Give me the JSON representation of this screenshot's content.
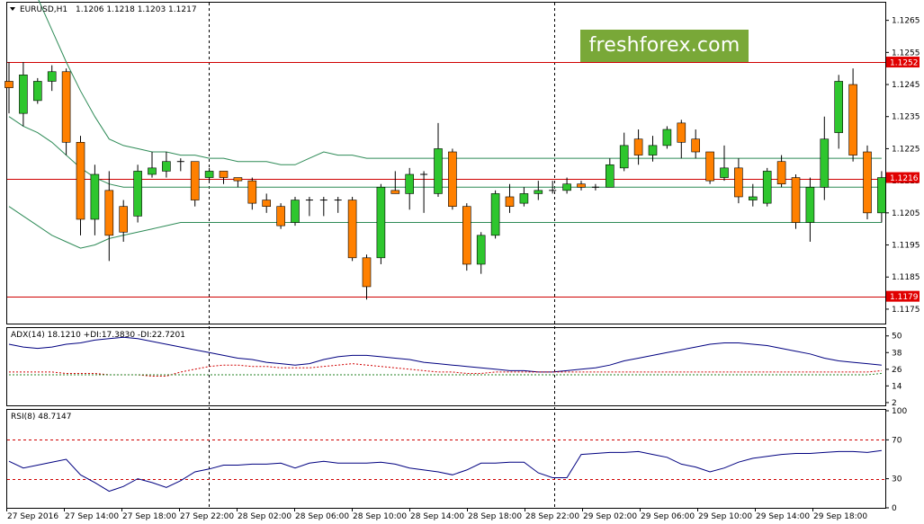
{
  "header": {
    "symbol": "EURUSD,H1",
    "ohlc": "1.1206 1.1218 1.1203 1.1217",
    "adx_label": "ADX(14) 18.1210 +DI:17.3830 -DI:22.7201",
    "rsi_label": "RSI(8) 48.7147"
  },
  "watermark": "freshforex.com",
  "chart_data": [
    {
      "type": "candlestick",
      "title": "EURUSD,H1",
      "ylim": [
        1.11705,
        1.12705
      ],
      "yticks": [
        "1.1265",
        "1.1255",
        "1.1245",
        "1.1235",
        "1.1225",
        "1.1215",
        "1.1205",
        "1.1195",
        "1.1185",
        "1.1175"
      ],
      "price_labels": [
        {
          "text": "1.1252",
          "value": 1.1252,
          "color": "#e00000"
        },
        {
          "text": "1.1216",
          "value": 1.1216,
          "color": "#e00000"
        },
        {
          "text": "1.1179",
          "value": 1.1179,
          "color": "#e00000"
        }
      ],
      "hlines": [
        {
          "value": 1.1252,
          "color": "#d00000"
        },
        {
          "value": 1.12155,
          "color": "#d00000"
        },
        {
          "value": 1.1179,
          "color": "#d00000"
        }
      ],
      "colors": {
        "bull": "#2ec62e",
        "bear": "#ff8000",
        "doji": "#000000",
        "bands": "#2e8b57"
      },
      "candles": [
        [
          1.1246,
          1.1244,
          1.1252,
          1.1236
        ],
        [
          1.1236,
          1.1248,
          1.1252,
          1.1232
        ],
        [
          1.124,
          1.1246,
          1.1247,
          1.1239
        ],
        [
          1.1246,
          1.1249,
          1.1251,
          1.1243
        ],
        [
          1.1249,
          1.1227,
          1.125,
          1.1223
        ],
        [
          1.1227,
          1.1203,
          1.1229,
          1.1198
        ],
        [
          1.1203,
          1.1217,
          1.122,
          1.1198
        ],
        [
          1.1212,
          1.1198,
          1.1218,
          1.119
        ],
        [
          1.1207,
          1.1199,
          1.1209,
          1.1196
        ],
        [
          1.1204,
          1.1218,
          1.122,
          1.1202
        ],
        [
          1.1217,
          1.1219,
          1.1224,
          1.1216
        ],
        [
          1.1218,
          1.1221,
          1.1224,
          1.1216
        ],
        [
          1.1221,
          1.1221,
          1.1222,
          1.1218
        ],
        [
          1.1221,
          1.1209,
          1.1221,
          1.1207
        ],
        [
          1.1216,
          1.1218,
          1.1219,
          1.1215
        ],
        [
          1.1218,
          1.1216,
          1.1218,
          1.1214
        ],
        [
          1.1216,
          1.1215,
          1.1216,
          1.1213
        ],
        [
          1.1215,
          1.1208,
          1.1216,
          1.1206
        ],
        [
          1.1209,
          1.1207,
          1.1211,
          1.1205
        ],
        [
          1.1207,
          1.1201,
          1.1208,
          1.12
        ],
        [
          1.1202,
          1.1209,
          1.121,
          1.1201
        ],
        [
          1.1209,
          1.1209,
          1.121,
          1.1204
        ],
        [
          1.1209,
          1.1209,
          1.121,
          1.1204
        ],
        [
          1.1209,
          1.1209,
          1.121,
          1.1205
        ],
        [
          1.1209,
          1.1191,
          1.121,
          1.119
        ],
        [
          1.1191,
          1.1182,
          1.1192,
          1.1178
        ],
        [
          1.1191,
          1.1213,
          1.1214,
          1.1189
        ],
        [
          1.1212,
          1.1211,
          1.1218,
          1.1211
        ],
        [
          1.1211,
          1.1217,
          1.1219,
          1.1206
        ],
        [
          1.1217,
          1.1217,
          1.1218,
          1.1205
        ],
        [
          1.1211,
          1.1225,
          1.1233,
          1.121
        ],
        [
          1.1224,
          1.1207,
          1.1225,
          1.1206
        ],
        [
          1.1207,
          1.1189,
          1.1208,
          1.1187
        ],
        [
          1.1189,
          1.1198,
          1.1199,
          1.1186
        ],
        [
          1.1198,
          1.1211,
          1.1212,
          1.1197
        ],
        [
          1.121,
          1.1207,
          1.1214,
          1.1205
        ],
        [
          1.1208,
          1.1211,
          1.1213,
          1.1207
        ],
        [
          1.1211,
          1.1212,
          1.1215,
          1.1209
        ],
        [
          1.1212,
          1.1212,
          1.1215,
          1.1211
        ],
        [
          1.1212,
          1.1214,
          1.1216,
          1.1211
        ],
        [
          1.1214,
          1.1213,
          1.1215,
          1.1212
        ],
        [
          1.1213,
          1.1213,
          1.1214,
          1.1212
        ],
        [
          1.1213,
          1.122,
          1.1222,
          1.1214
        ],
        [
          1.1219,
          1.1226,
          1.123,
          1.1218
        ],
        [
          1.1228,
          1.1223,
          1.1231,
          1.122
        ],
        [
          1.1223,
          1.1226,
          1.1229,
          1.1221
        ],
        [
          1.1226,
          1.1231,
          1.1232,
          1.1225
        ],
        [
          1.1233,
          1.1227,
          1.1234,
          1.1222
        ],
        [
          1.1228,
          1.1224,
          1.1231,
          1.1222
        ],
        [
          1.1224,
          1.1215,
          1.1224,
          1.1214
        ],
        [
          1.1216,
          1.1219,
          1.1226,
          1.1215
        ],
        [
          1.1219,
          1.121,
          1.1222,
          1.1208
        ],
        [
          1.1209,
          1.121,
          1.1214,
          1.1207
        ],
        [
          1.1208,
          1.1218,
          1.1219,
          1.1207
        ],
        [
          1.1221,
          1.1214,
          1.1223,
          1.1213
        ],
        [
          1.1216,
          1.1202,
          1.1217,
          1.12
        ],
        [
          1.1202,
          1.1213,
          1.1216,
          1.1196
        ],
        [
          1.1213,
          1.1228,
          1.1235,
          1.1209
        ],
        [
          1.123,
          1.1246,
          1.1248,
          1.1225
        ],
        [
          1.1245,
          1.1223,
          1.125,
          1.1221
        ],
        [
          1.1224,
          1.1205,
          1.1226,
          1.1203
        ],
        [
          1.1205,
          1.1216,
          1.1218,
          1.1202
        ]
      ],
      "bands": {
        "upper": [
          1.1295,
          1.1282,
          1.1272,
          1.1262,
          1.1252,
          1.1243,
          1.1235,
          1.1228,
          1.1226,
          1.1225,
          1.1224,
          1.1224,
          1.1223,
          1.1223,
          1.1222,
          1.1222,
          1.1221,
          1.1221,
          1.1221,
          1.122,
          1.122,
          1.1222,
          1.1224,
          1.1223,
          1.1223,
          1.1222,
          1.1222,
          1.1222,
          1.1222,
          1.1222,
          1.1222,
          1.1222,
          1.1222,
          1.1222,
          1.1222,
          1.1222,
          1.1222,
          1.1222,
          1.1222,
          1.1222,
          1.1222,
          1.1222,
          1.1222,
          1.1222,
          1.1222,
          1.1222,
          1.1222,
          1.1222,
          1.1222,
          1.1222,
          1.1222,
          1.1222,
          1.1222,
          1.1222,
          1.1222,
          1.1222,
          1.1222,
          1.1222,
          1.1222,
          1.1222,
          1.1222,
          1.1222
        ],
        "middle": [
          1.1235,
          1.1232,
          1.123,
          1.1227,
          1.1223,
          1.1219,
          1.1216,
          1.1214,
          1.1213,
          1.1213,
          1.1213,
          1.1213,
          1.1213,
          1.1213,
          1.1213,
          1.1213,
          1.1213,
          1.1213,
          1.1213,
          1.1213,
          1.1213,
          1.1213,
          1.1213,
          1.1213,
          1.1213,
          1.1213,
          1.1213,
          1.1213,
          1.1213,
          1.1213,
          1.1213,
          1.1213,
          1.1213,
          1.1213,
          1.1213,
          1.1213,
          1.1213,
          1.1213,
          1.1213,
          1.1213,
          1.1213,
          1.1213,
          1.1213,
          1.1213,
          1.1213,
          1.1213,
          1.1213,
          1.1213,
          1.1213,
          1.1213,
          1.1213,
          1.1213,
          1.1213,
          1.1213,
          1.1213,
          1.1213,
          1.1213,
          1.1213,
          1.1213,
          1.1213,
          1.1213,
          1.1213
        ],
        "lower": [
          1.1207,
          1.1204,
          1.1201,
          1.1198,
          1.1196,
          1.1194,
          1.1195,
          1.1197,
          1.1198,
          1.1199,
          1.12,
          1.1201,
          1.1202,
          1.1202,
          1.1202,
          1.1202,
          1.1202,
          1.1202,
          1.1202,
          1.1202,
          1.1202,
          1.1202,
          1.1202,
          1.1202,
          1.1202,
          1.1202,
          1.1202,
          1.1202,
          1.1202,
          1.1202,
          1.1202,
          1.1202,
          1.1202,
          1.1202,
          1.1202,
          1.1202,
          1.1202,
          1.1202,
          1.1202,
          1.1202,
          1.1202,
          1.1202,
          1.1202,
          1.1202,
          1.1202,
          1.1202,
          1.1202,
          1.1202,
          1.1202,
          1.1202,
          1.1202,
          1.1202,
          1.1202,
          1.1202,
          1.1202,
          1.1202,
          1.1202,
          1.1202,
          1.1202,
          1.1202,
          1.1202,
          1.1202
        ]
      }
    },
    {
      "type": "line",
      "title": "ADX(14) 18.1210 +DI:17.3830 -DI:22.7201",
      "ylim": [
        0,
        55
      ],
      "yticks": [
        "50",
        "38",
        "26",
        "14",
        "2"
      ],
      "series": [
        {
          "values": [
            44,
            42,
            41,
            42,
            44,
            45,
            47,
            48,
            49,
            48,
            46,
            44,
            42,
            40,
            38,
            36,
            34,
            33,
            31,
            30,
            29,
            30,
            33,
            35,
            36,
            36,
            35,
            34,
            33,
            31,
            30,
            29,
            28,
            27,
            26,
            25,
            25,
            24,
            24,
            25,
            26,
            27,
            29,
            32,
            34,
            36,
            38,
            40,
            42,
            44,
            45,
            45,
            44,
            43,
            41,
            39,
            37,
            34,
            32,
            31,
            30,
            29
          ]
        },
        {
          "values": [
            24,
            24,
            24,
            24,
            23,
            23,
            23,
            22,
            22,
            22,
            21,
            21,
            24,
            26,
            28,
            29,
            29,
            28,
            28,
            27,
            27,
            27,
            28,
            29,
            30,
            29,
            28,
            27,
            26,
            25,
            24,
            24,
            23,
            23,
            24,
            24,
            24,
            24,
            24,
            24,
            24,
            24,
            24,
            24,
            24,
            24,
            24,
            24,
            24,
            24,
            24,
            24,
            24,
            24,
            24,
            24,
            24,
            24,
            24,
            24,
            24,
            25
          ]
        },
        {
          "values": [
            22,
            22,
            22,
            22,
            22,
            22,
            22,
            22,
            22,
            22,
            22,
            22,
            22,
            22,
            22,
            22,
            22,
            22,
            22,
            22,
            22,
            22,
            22,
            22,
            22,
            22,
            22,
            22,
            22,
            22,
            22,
            22,
            22,
            22,
            22,
            22,
            22,
            22,
            22,
            22,
            22,
            22,
            22,
            22,
            22,
            22,
            22,
            22,
            22,
            22,
            22,
            22,
            22,
            22,
            22,
            22,
            22,
            22,
            22,
            22,
            22,
            23
          ]
        }
      ]
    },
    {
      "type": "line",
      "title": "RSI(8) 48.7147",
      "ylim": [
        0,
        100
      ],
      "yticks": [
        "100",
        "70",
        "30",
        "0"
      ],
      "levels": [
        70,
        30
      ],
      "series": [
        {
          "values": [
            48,
            41,
            44,
            47,
            50,
            34,
            26,
            17,
            22,
            30,
            26,
            21,
            28,
            37,
            40,
            44,
            44,
            45,
            45,
            46,
            41,
            46,
            48,
            46,
            46,
            46,
            47,
            45,
            41,
            39,
            37,
            34,
            39,
            46,
            46,
            47,
            47,
            36,
            31,
            31,
            55,
            56,
            57,
            57,
            58,
            55,
            52,
            45,
            42,
            37,
            41,
            47,
            51,
            53,
            55,
            56,
            56,
            57,
            58,
            58,
            57,
            59
          ]
        }
      ]
    }
  ],
  "x_tick_labels": [
    "27 Sep 2016",
    "27 Sep 14:00",
    "27 Sep 18:00",
    "27 Sep 22:00",
    "28 Sep 02:00",
    "28 Sep 06:00",
    "28 Sep 10:00",
    "28 Sep 14:00",
    "28 Sep 18:00",
    "28 Sep 22:00",
    "29 Sep 02:00",
    "29 Sep 06:00",
    "29 Sep 10:00",
    "29 Sep 14:00",
    "29 Sep 18:00"
  ]
}
